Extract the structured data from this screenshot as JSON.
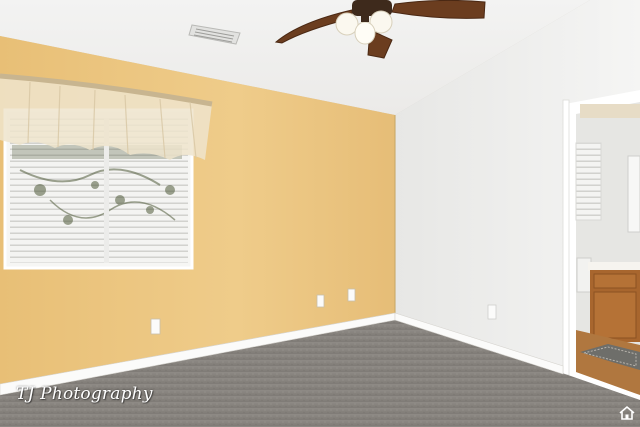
{
  "photo": {
    "watermark_text": "TJ Photography",
    "corner_icon": "home-icon"
  },
  "colors": {
    "ceiling": "#f1f0ee",
    "accent_wall": "#e9c47e",
    "side_wall": "#eeeeec",
    "carpet": "#8c8883",
    "baseboard": "#fbfbfa",
    "vanity_wood": "#a8662e",
    "fan_blade": "#6b3d1f"
  }
}
